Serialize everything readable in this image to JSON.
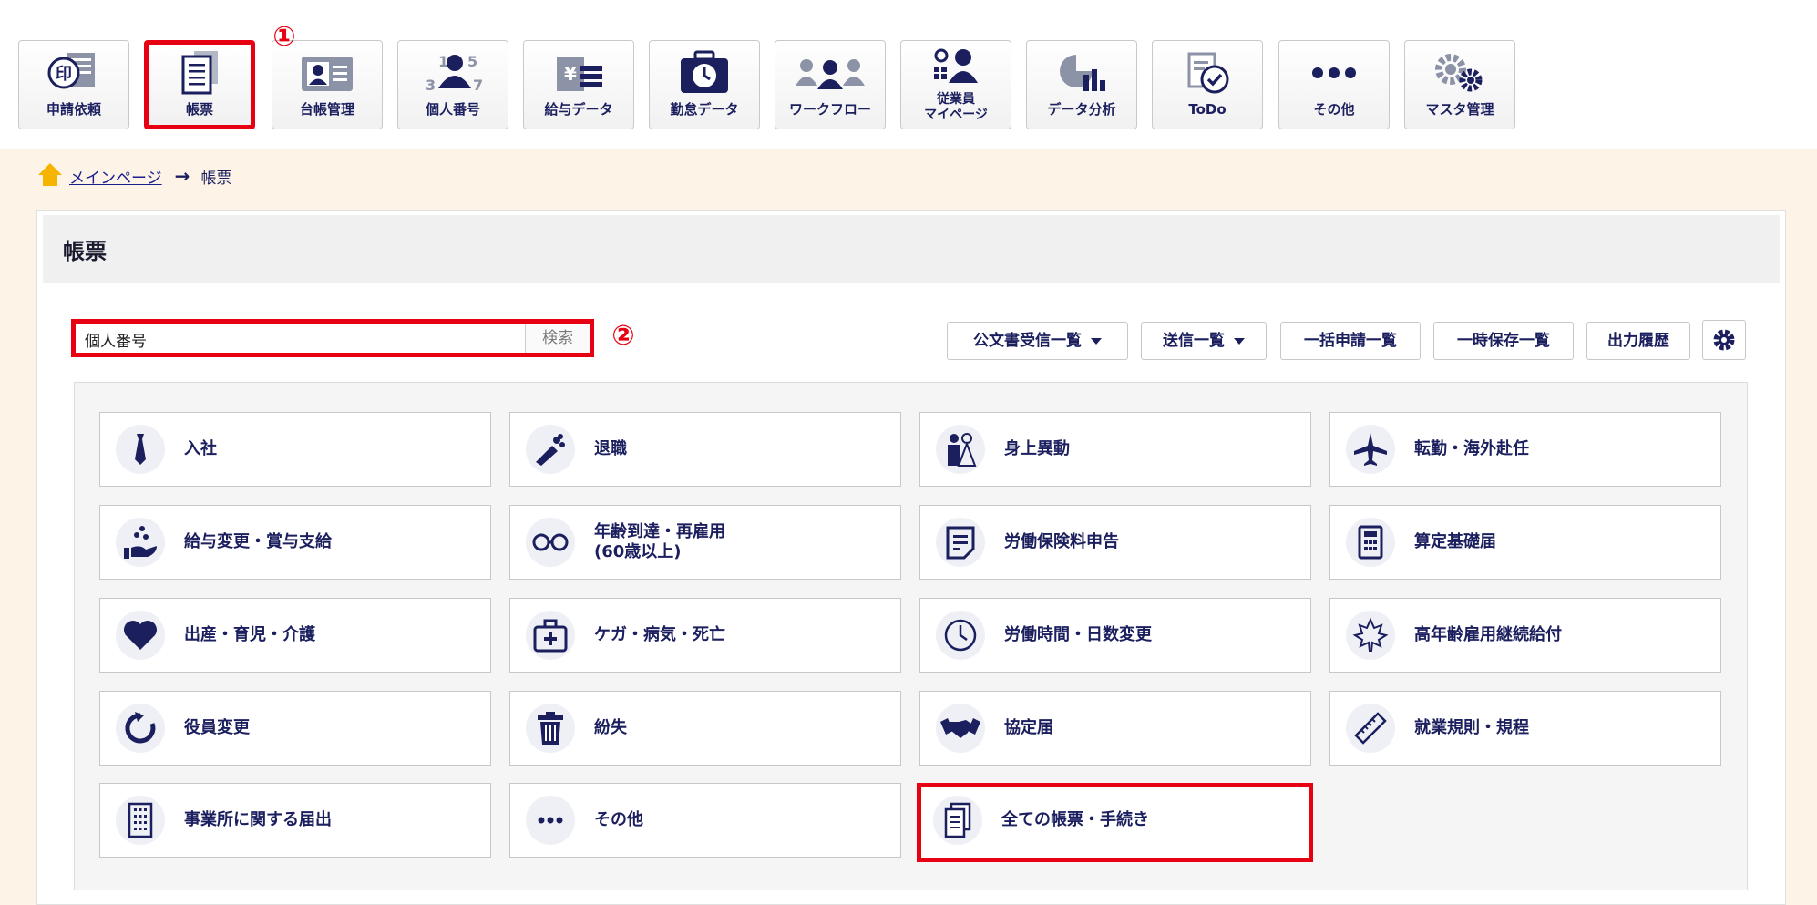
{
  "topnav": {
    "items": [
      {
        "label": "申請依頼",
        "icon": "stamp-document-icon"
      },
      {
        "label": "帳票",
        "icon": "document-list-icon"
      },
      {
        "label": "台帳管理",
        "icon": "id-card-icon"
      },
      {
        "label": "個人番号",
        "icon": "person-number-icon"
      },
      {
        "label": "給与データ",
        "icon": "salary-yen-icon"
      },
      {
        "label": "勤怠データ",
        "icon": "attendance-clock-icon"
      },
      {
        "label": "ワークフロー",
        "icon": "workflow-people-icon"
      },
      {
        "label": "従業員\nマイページ",
        "icon": "employee-mypage-icon"
      },
      {
        "label": "データ分析",
        "icon": "chart-icon"
      },
      {
        "label": "ToDo",
        "icon": "todo-check-icon"
      },
      {
        "label": "その他",
        "icon": "more-dots-icon"
      },
      {
        "label": "マスタ管理",
        "icon": "gears-icon"
      }
    ],
    "selected": "帳票"
  },
  "callouts": {
    "one": "①",
    "two": "②"
  },
  "breadcrumb": {
    "home": "メインページ",
    "current": "帳票"
  },
  "page": {
    "title": "帳票"
  },
  "search": {
    "value": "個人番号",
    "button": "検索"
  },
  "toolbar": {
    "received": "公文書受信一覧",
    "sent": "送信一覧",
    "bulk": "一括申請一覧",
    "temp": "一時保存一覧",
    "history": "出力履歴"
  },
  "categories": [
    {
      "label": "入社",
      "icon": "necktie-icon"
    },
    {
      "label": "退職",
      "icon": "bouquet-icon"
    },
    {
      "label": "身上異動",
      "icon": "couple-icon"
    },
    {
      "label": "転勤・海外赴任",
      "icon": "airplane-icon"
    },
    {
      "label": "給与変更・賞与支給",
      "icon": "hand-coins-icon"
    },
    {
      "label": "年齢到達・再雇用\n(60歳以上)",
      "icon": "glasses-icon"
    },
    {
      "label": "労働保険料申告",
      "icon": "form-icon"
    },
    {
      "label": "算定基礎届",
      "icon": "calculator-icon"
    },
    {
      "label": "出産・育児・介護",
      "icon": "heart-icon"
    },
    {
      "label": "ケガ・病気・死亡",
      "icon": "first-aid-icon"
    },
    {
      "label": "労働時間・日数変更",
      "icon": "clock-icon"
    },
    {
      "label": "高年齢雇用継続給付",
      "icon": "maple-leaf-icon"
    },
    {
      "label": "役員変更",
      "icon": "refresh-icon"
    },
    {
      "label": "紛失",
      "icon": "trash-icon"
    },
    {
      "label": "協定届",
      "icon": "handshake-icon"
    },
    {
      "label": "就業規則・規程",
      "icon": "ruler-icon"
    },
    {
      "label": "事業所に関する届出",
      "icon": "building-icon"
    },
    {
      "label": "その他",
      "icon": "ellipsis-icon"
    },
    {
      "label": "全ての帳票・手続き",
      "icon": "documents-icon"
    }
  ],
  "colors": {
    "accent": "#e60012",
    "navy": "#1b1f5e",
    "band": "#fdf4e7",
    "home": "#f5b400"
  }
}
